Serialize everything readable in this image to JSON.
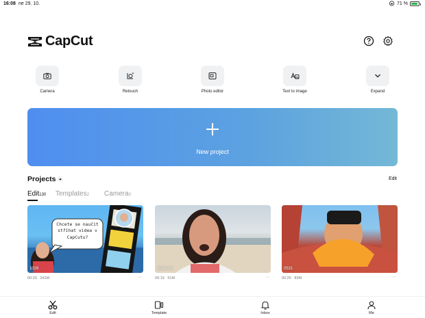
{
  "status": {
    "time": "16:08",
    "date": "ne 29. 10.",
    "battery_text": "71 %",
    "battery_level": 0.71
  },
  "app": {
    "name": "CapCut"
  },
  "tools": [
    {
      "label": "Camera",
      "icon": "camera-icon"
    },
    {
      "label": "Retouch",
      "icon": "retouch-icon"
    },
    {
      "label": "Photo editor",
      "icon": "photo-editor-icon"
    },
    {
      "label": "Text to image",
      "icon": "text-to-image-icon"
    },
    {
      "label": "Expand",
      "icon": "chevron-down-icon"
    }
  ],
  "new_project": {
    "label": "New project"
  },
  "projects": {
    "title": "Projects",
    "edit_label": "Edit",
    "tabs": [
      {
        "label": "Edit",
        "count": "130"
      },
      {
        "label": "Templates",
        "count": "2"
      },
      {
        "label": "Camera",
        "count": "0"
      }
    ],
    "items": [
      {
        "label": "1028",
        "duration": "00:33",
        "size": "241M",
        "overlay_text": "Chcete se naučit stříhat videa v CapCutu?"
      },
      {
        "label": "1028–02",
        "duration": "00:19",
        "size": "51M"
      },
      {
        "label": "0531",
        "duration": "00:25",
        "size": "83M"
      }
    ]
  },
  "nav": [
    {
      "label": "Edit",
      "icon": "scissors-icon"
    },
    {
      "label": "Template",
      "icon": "template-icon"
    },
    {
      "label": "Inbox",
      "icon": "bell-icon"
    },
    {
      "label": "Me",
      "icon": "person-icon"
    }
  ],
  "colors": {
    "banner_start": "#4f8ef0",
    "banner_end": "#74b8d6",
    "battery": "#2bb34a"
  }
}
